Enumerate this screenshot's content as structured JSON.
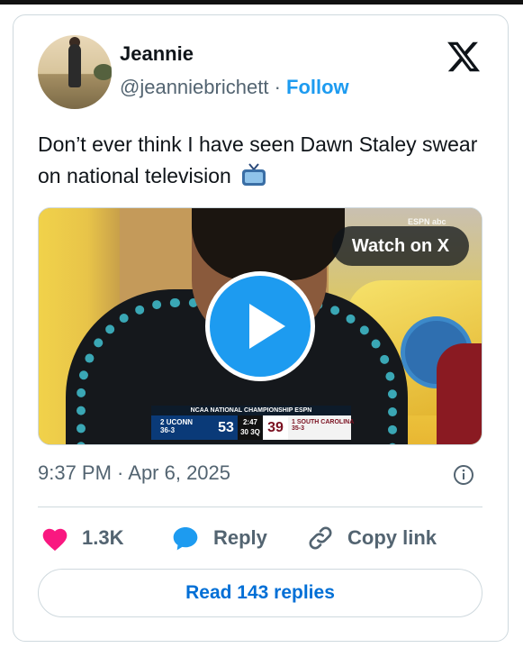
{
  "author": {
    "name": "Jeannie",
    "handle": "@jeanniebrichett",
    "separator": "·",
    "follow_label": "Follow"
  },
  "brand": {
    "logo": "x-logo-icon"
  },
  "tweet": {
    "text": "Don’t ever think I have seen Dawn Staley swear on national television",
    "emoji": "television-emoji"
  },
  "media": {
    "watch_label": "Watch on X",
    "play_icon": "play-icon",
    "network_watermark": "ESPN abc",
    "scorebug": {
      "title": "NCAA NATIONAL CHAMPIONSHIP",
      "network": "ESPN",
      "team1_seed": "2",
      "team1_name": "UCONN",
      "team1_record": "36-3",
      "team1_score": "53",
      "clock": "2:47",
      "shot_clock": "30",
      "period": "3Q",
      "team2_score": "39",
      "team2_seed": "1",
      "team2_name": "SOUTH CAROLINA",
      "team2_record": "35-3"
    }
  },
  "timestamp": "9:37 PM · Apr 6, 2025",
  "actions": {
    "like_count": "1.3K",
    "reply_label": "Reply",
    "copy_label": "Copy link"
  },
  "read_replies_label": "Read 143 replies",
  "colors": {
    "accent": "#1d9bf0",
    "heart": "#f91880",
    "muted": "#536471",
    "text": "#0f1419",
    "border": "#cfd9de"
  }
}
